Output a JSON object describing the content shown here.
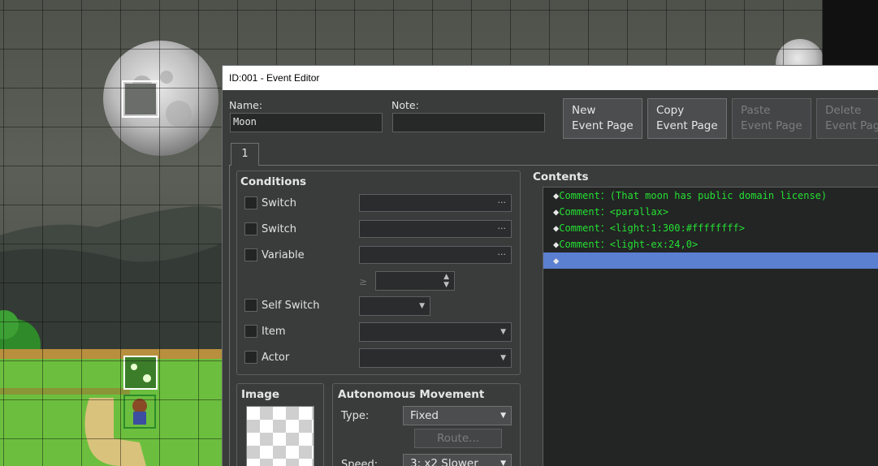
{
  "window": {
    "title": "ID:001 - Event Editor"
  },
  "header": {
    "name_label": "Name:",
    "name_value": "Moon",
    "note_label": "Note:",
    "note_value": "",
    "buttons": [
      {
        "line1": "New",
        "line2": "Event Page",
        "enabled": true
      },
      {
        "line1": "Copy",
        "line2": "Event Page",
        "enabled": true
      },
      {
        "line1": "Paste",
        "line2": "Event Page",
        "enabled": false
      },
      {
        "line1": "Delete",
        "line2": "Event Page",
        "enabled": false
      }
    ]
  },
  "tabs": [
    {
      "label": "1"
    }
  ],
  "conditions": {
    "title": "Conditions",
    "rows": [
      {
        "label": "Switch",
        "control": "ellipsis"
      },
      {
        "label": "Switch",
        "control": "ellipsis"
      },
      {
        "label": "Variable",
        "control": "ellipsis"
      },
      {
        "label": "Self Switch",
        "control": "dropdown"
      },
      {
        "label": "Item",
        "control": "dropdown"
      },
      {
        "label": "Actor",
        "control": "dropdown"
      }
    ],
    "ge_symbol": "≥",
    "ellipsis": "···"
  },
  "image": {
    "title": "Image"
  },
  "movement": {
    "title": "Autonomous Movement",
    "type_label": "Type:",
    "type_value": "Fixed",
    "route_label": "Route...",
    "speed_label": "Speed:",
    "speed_value": "3: x2 Slower"
  },
  "contents": {
    "title": "Contents",
    "diamond": "◆",
    "lines": [
      "Comment：(That moon has public domain license)",
      "Comment：<parallax>",
      "Comment：<light:1:300:#ffffffff>",
      "Comment：<light-ex:24,0>",
      ""
    ],
    "selected_index": 4
  },
  "colors": {
    "comment_text": "#24e033",
    "selection": "#5b7fd1"
  }
}
